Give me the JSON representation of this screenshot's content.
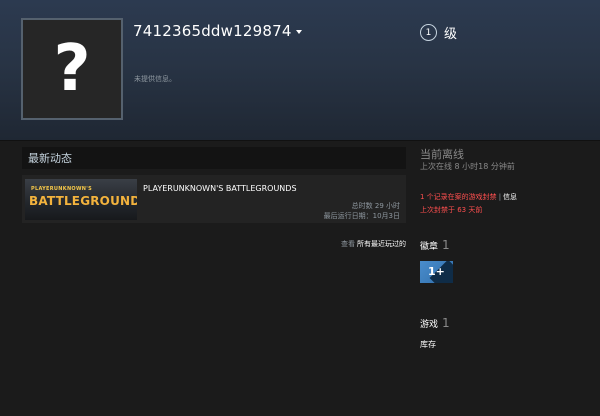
{
  "header": {
    "persona_name": "7412365ddw129874",
    "no_info": "未提供信息。",
    "avatar_placeholder": "?",
    "level_number": "1",
    "level_label": "级"
  },
  "activity": {
    "title": "最新动态",
    "game": {
      "capsule_top": "PLAYERUNKNOWN'S",
      "capsule_main": "BATTLEGROUNDS",
      "name": "PLAYERUNKNOWN'S BATTLEGROUNDS",
      "hours": "总时数 29 小时",
      "last_played": "最后运行日期：10月3日"
    },
    "view_prefix": "查看",
    "view_link": "所有最近玩过的"
  },
  "sidebar": {
    "status_title": "当前离线",
    "status_sub": "上次在线 8 小时18 分钟前",
    "ban_record": "1 个记录在案的游戏封禁",
    "ban_sep": "|",
    "ban_info": "信息",
    "ban_last": "上次封禁于 63 天前",
    "badges_label": "徽章",
    "badges_count": "1",
    "badge_text": "1+",
    "games_label": "游戏",
    "games_count": "1",
    "library_label": "库存"
  },
  "colors": {
    "header_bg": "#283445",
    "ban_red": "#ff4f4f",
    "badge_blue": "#4a8dcd"
  }
}
